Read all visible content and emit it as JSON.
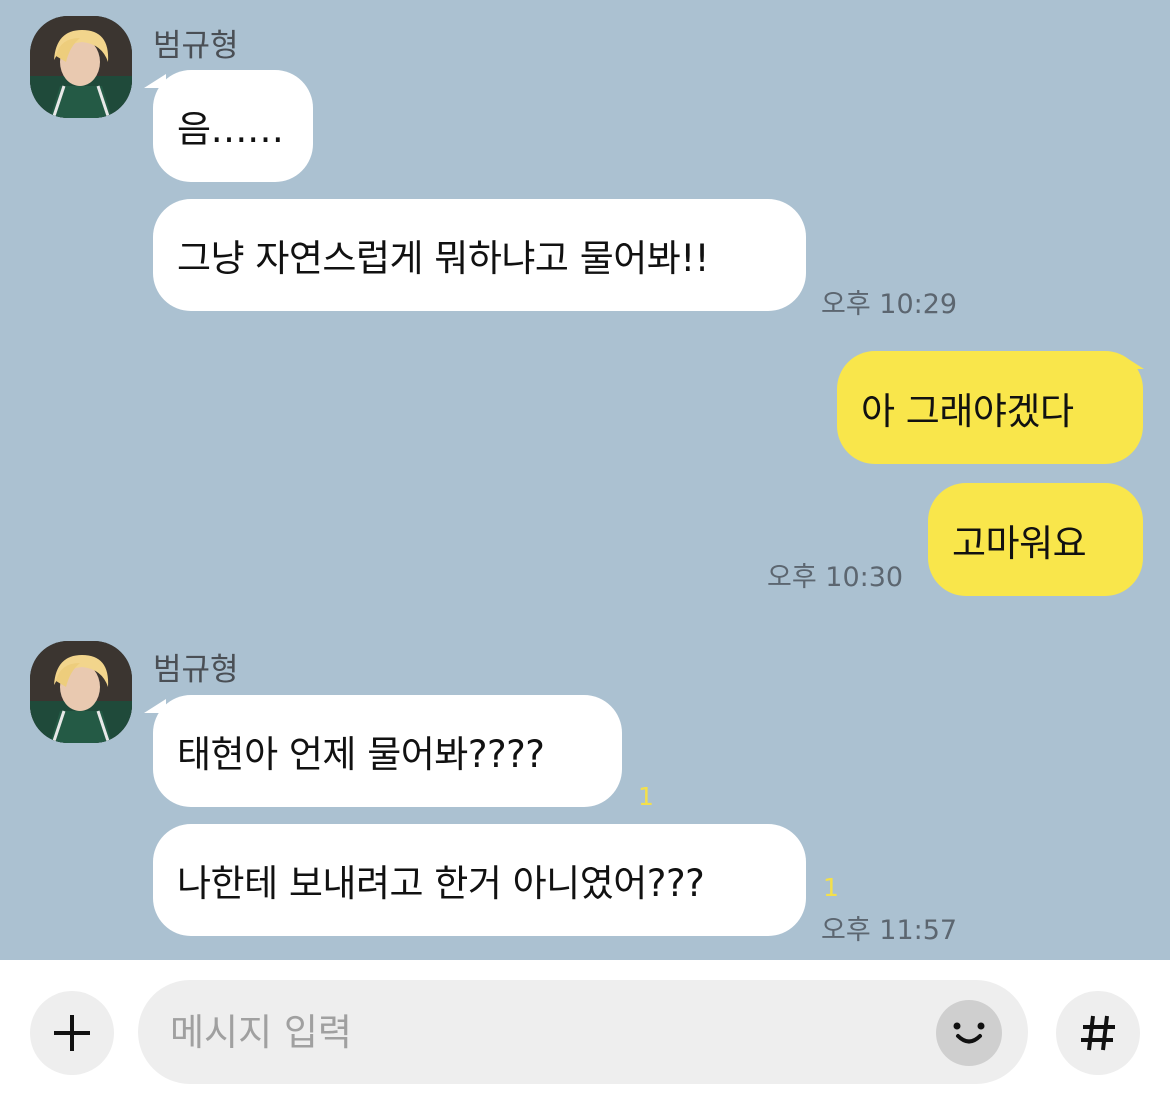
{
  "colors": {
    "chat_background": "#abc1d1",
    "incoming_bubble": "#ffffff",
    "outgoing_bubble": "#f9e64b",
    "unread_count": "#f4e04a"
  },
  "groups": [
    {
      "sender": "범규형",
      "messages": [
        {
          "text": "음……"
        },
        {
          "text": "그냥 자연스럽게 뭐하냐고 물어봐!!",
          "time": "오후 10:29"
        }
      ]
    },
    {
      "sender": "me",
      "messages": [
        {
          "text": "아 그래야겠다"
        },
        {
          "text": "고마워요",
          "time": "오후 10:30"
        }
      ]
    },
    {
      "sender": "범규형",
      "messages": [
        {
          "text": "태현아 언제 물어봐????",
          "unread": "1"
        },
        {
          "text": "나한테 보내려고 한거 아니였어???",
          "unread": "1",
          "time": "오후 11:57"
        }
      ]
    }
  ],
  "composer": {
    "add_icon": "plus-icon",
    "placeholder": "메시지 입력",
    "emoji_icon": "smiley-icon",
    "hash_icon": "hash-icon"
  }
}
